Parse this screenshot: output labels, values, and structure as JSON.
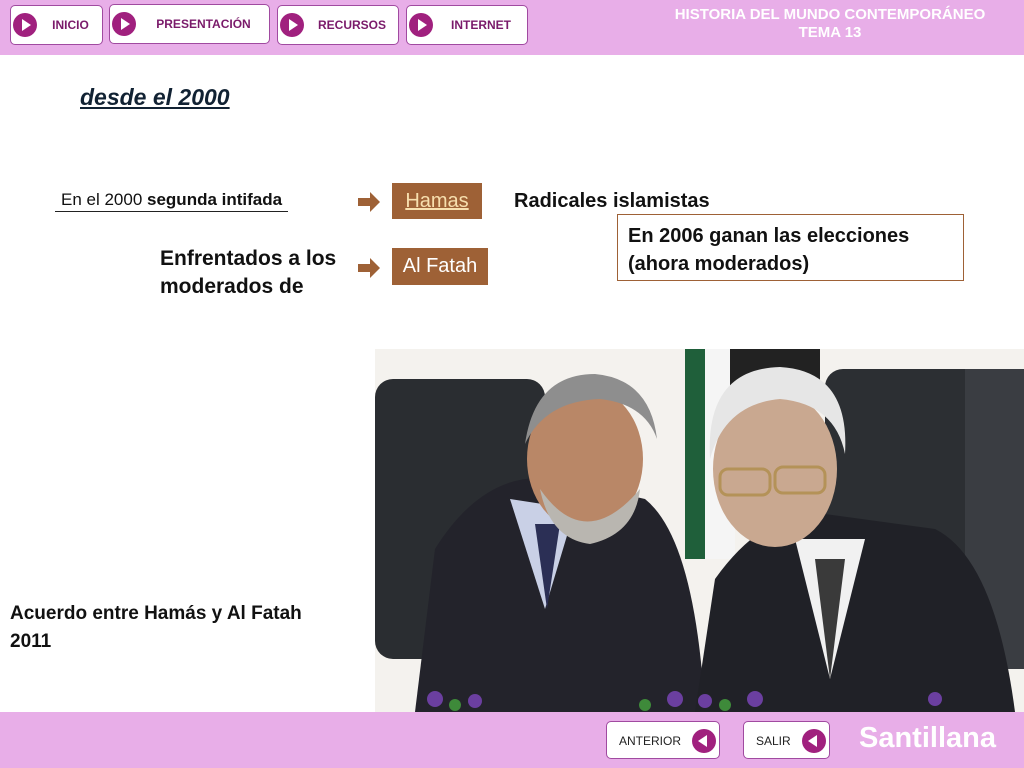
{
  "nav": {
    "buttons": [
      "INICIO",
      "PRESENTACIÓN",
      "RECURSOS",
      "INTERNET"
    ]
  },
  "header": {
    "title_line1": "HISTORIA DEL MUNDO CONTEMPORÁNEO",
    "title_line2": "TEMA 13"
  },
  "content": {
    "heading": "desde el 2000",
    "intifada_prefix": "En el 2000 ",
    "intifada_bold": "segunda intifada",
    "hamas": "Hamas",
    "al_fatah": "Al Fatah",
    "radicales": "Radicales islamistas",
    "elecciones_line1": "En 2006 ganan las elecciones",
    "elecciones_line2": "(ahora moderados)",
    "enfrentados_line1": "Enfrentados a los",
    "enfrentados_line2": "moderados de",
    "caption_line1": "Acuerdo entre Hamás y Al Fatah",
    "caption_line2": "2011"
  },
  "footer": {
    "anterior": "ANTERIOR",
    "salir": "SALIR",
    "brand": "Santillana"
  },
  "colors": {
    "bar": "#e8aee8",
    "accent": "#a0207e",
    "box": "#9e6136"
  }
}
